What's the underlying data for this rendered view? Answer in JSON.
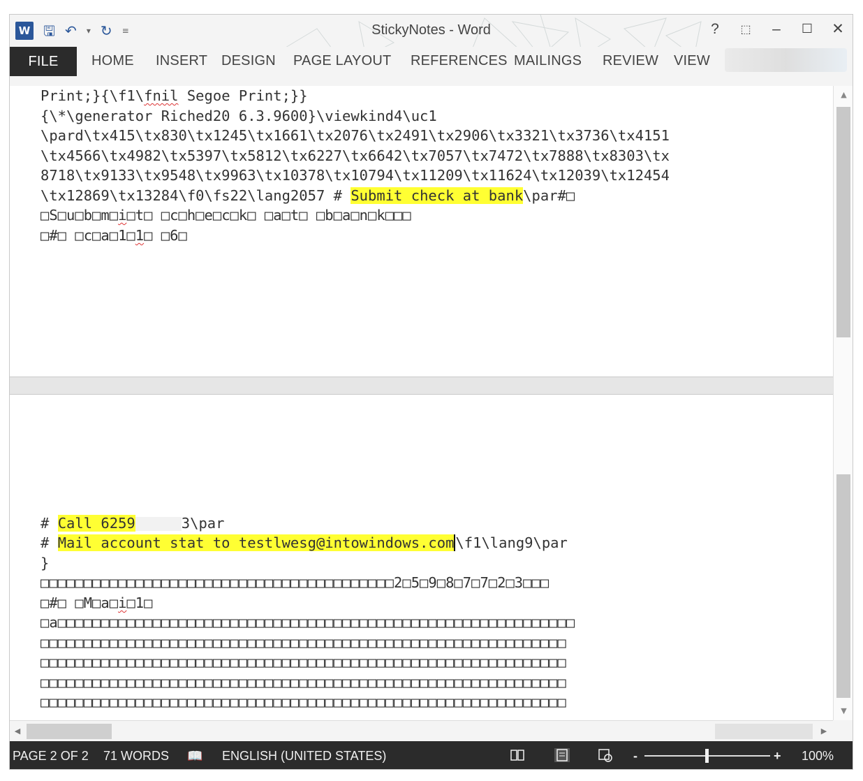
{
  "app": {
    "title": "StickyNotes - Word",
    "help": "?",
    "word_icon_letter": "W"
  },
  "ribbon": {
    "tabs": [
      "FILE",
      "HOME",
      "INSERT",
      "DESIGN",
      "PAGE LAYOUT",
      "REFERENCES",
      "MAILINGS",
      "REVIEW",
      "VIEW"
    ]
  },
  "document": {
    "top_pane": {
      "l1a": "Print;}{\\f1\\",
      "l1b": "fnil",
      "l1c": " Segoe Print;}}",
      "l2": "{\\*\\generator Riched20 6.3.9600}\\viewkind4\\uc1",
      "l3": "\\pard\\tx415\\tx830\\tx1245\\tx1661\\tx2076\\tx2491\\tx2906\\tx3321\\tx3736\\tx4151",
      "l4": "\\tx4566\\tx4982\\tx5397\\tx5812\\tx6227\\tx6642\\tx7057\\tx7472\\tx7888\\tx8303\\tx",
      "l5": "8718\\tx9133\\tx9548\\tx9963\\tx10378\\tx10794\\tx11209\\tx11624\\tx12039\\tx12454",
      "l6a": "\\tx12869\\tx13284\\f0\\fs22\\lang2057 # ",
      "l6_highlight": "Submit check at bank",
      "l6b": "\\par#□",
      "l7a": "□S□u□b□m□",
      "l7b": "i",
      "l7c": "□t□ □c□h□e□c□k□ □a□t□ □b□a□n□k□□□",
      "l8a": "□#□ □c□a□1□",
      "l8b": "1",
      "l8c": "□ □6□"
    },
    "bottom_pane": {
      "b1_hash": "# ",
      "b1_highlight": "Call 6259",
      "b1_tail": "3\\par",
      "b2_hash": "# ",
      "b2_highlight": "Mail account stat to testlwesg@intowindows.com",
      "b2_tail": "\\f1\\lang9\\par",
      "b3": "}",
      "b4": "□□□□□□□□□□□□□□□□□□□□□□□□□□□□□□□□□□□□□□□□□2□5□9□8□7□7□2□3□□□",
      "b5a": "□#□ □M□a□",
      "b5b": "i",
      "b5c": "□1□",
      "b6": "□a□□□□□□□□□□□□□□□□□□□□□□□□□□□□□□□□□□□□□□□□□□□□□□□□□□□□□□□□□□□□",
      "b7": "□□□□□□□□□□□□□□□□□□□□□□□□□□□□□□□□□□□□□□□□□□□□□□□□□□□□□□□□□□□□□",
      "b8": "□□□□□□□□□□□□□□□□□□□□□□□□□□□□□□□□□□□□□□□□□□□□□□□□□□□□□□□□□□□□□",
      "b9": "□□□□□□□□□□□□□□□□□□□□□□□□□□□□□□□□□□□□□□□□□□□□□□□□□□□□□□□□□□□□□",
      "b10": "□□□□□□□□□□□□□□□□□□□□□□□□□□□□□□□□□□□□□□□□□□□□□□□□□□□□□□□□□□□□□",
      "b11": "□□□□□□□□□□□□□□□□□□□□□□□□□□□□□□□□□□□□□□□□□□□□□"
    }
  },
  "statusbar": {
    "page": "PAGE 2 OF 2",
    "words": "71 WORDS",
    "language": "ENGLISH (UNITED STATES)",
    "zoom_minus": "-",
    "zoom_plus": "+",
    "zoom": "100%"
  },
  "colors": {
    "highlight": "#ffff33",
    "statusbar": "#2b2b2b",
    "file_tab": "#2b2b2b",
    "accent": "#2b579a"
  }
}
